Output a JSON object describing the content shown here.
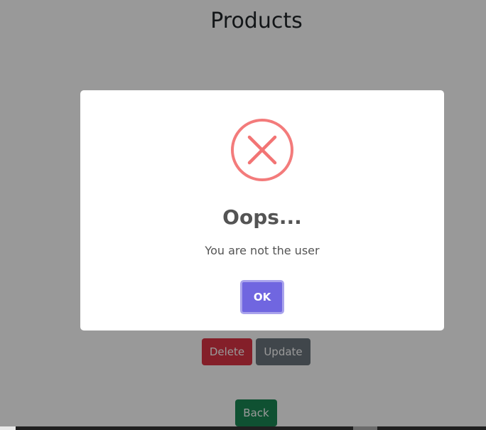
{
  "page": {
    "title": "Products",
    "delete_label": "Delete",
    "update_label": "Update",
    "back_label": "Back"
  },
  "dialog": {
    "icon": "error-x-icon",
    "icon_color": "#f27474",
    "title": "Oops...",
    "text": "You are not the user",
    "confirm_label": "OK",
    "confirm_color": "#7066e0"
  },
  "colors": {
    "delete": "#dc3545",
    "update": "#6c757d",
    "back": "#198754"
  }
}
